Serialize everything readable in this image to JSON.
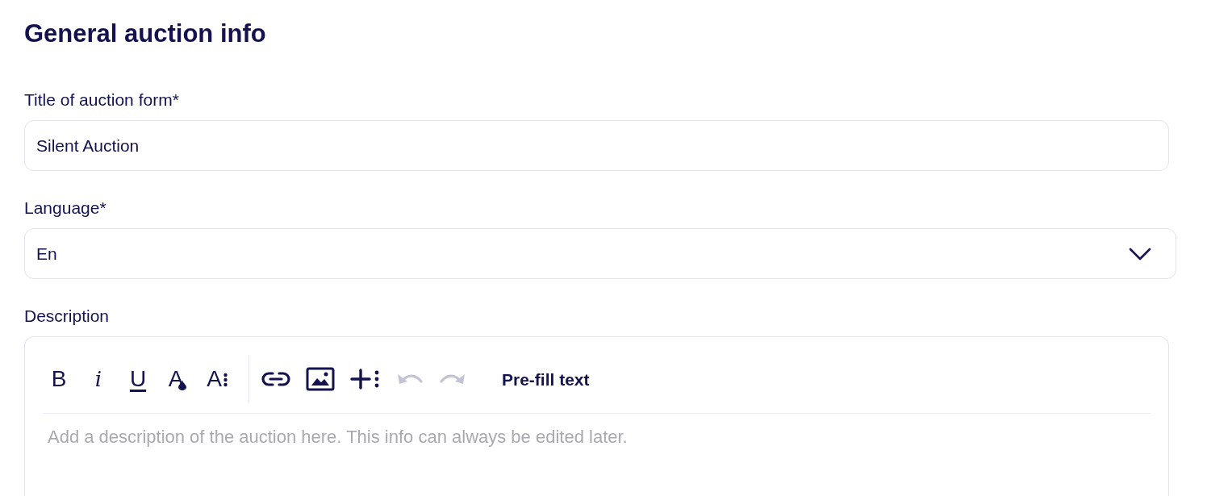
{
  "heading": "General auction info",
  "title_field": {
    "label": "Title of auction form*",
    "value": "Silent Auction"
  },
  "language_field": {
    "label": "Language*",
    "value": "En"
  },
  "description": {
    "label": "Description",
    "toolbar_groups": [
      [
        {
          "kind": "bold",
          "label": "B",
          "disabled": false
        },
        {
          "kind": "italic",
          "label": "i",
          "disabled": false
        },
        {
          "kind": "underline",
          "label": "U",
          "disabled": false
        },
        {
          "kind": "text-color",
          "label": "A",
          "disabled": false
        },
        {
          "kind": "text-size",
          "label": "A",
          "disabled": false
        }
      ],
      [
        {
          "kind": "link",
          "disabled": false
        },
        {
          "kind": "image",
          "disabled": false
        },
        {
          "kind": "insert",
          "disabled": false
        },
        {
          "kind": "undo",
          "disabled": true
        },
        {
          "kind": "redo",
          "disabled": true
        },
        {
          "kind": "prefill",
          "label": "Pre-fill text",
          "disabled": false
        }
      ]
    ],
    "placeholder": "Add a description of the auction here. This info can always be edited later."
  }
}
